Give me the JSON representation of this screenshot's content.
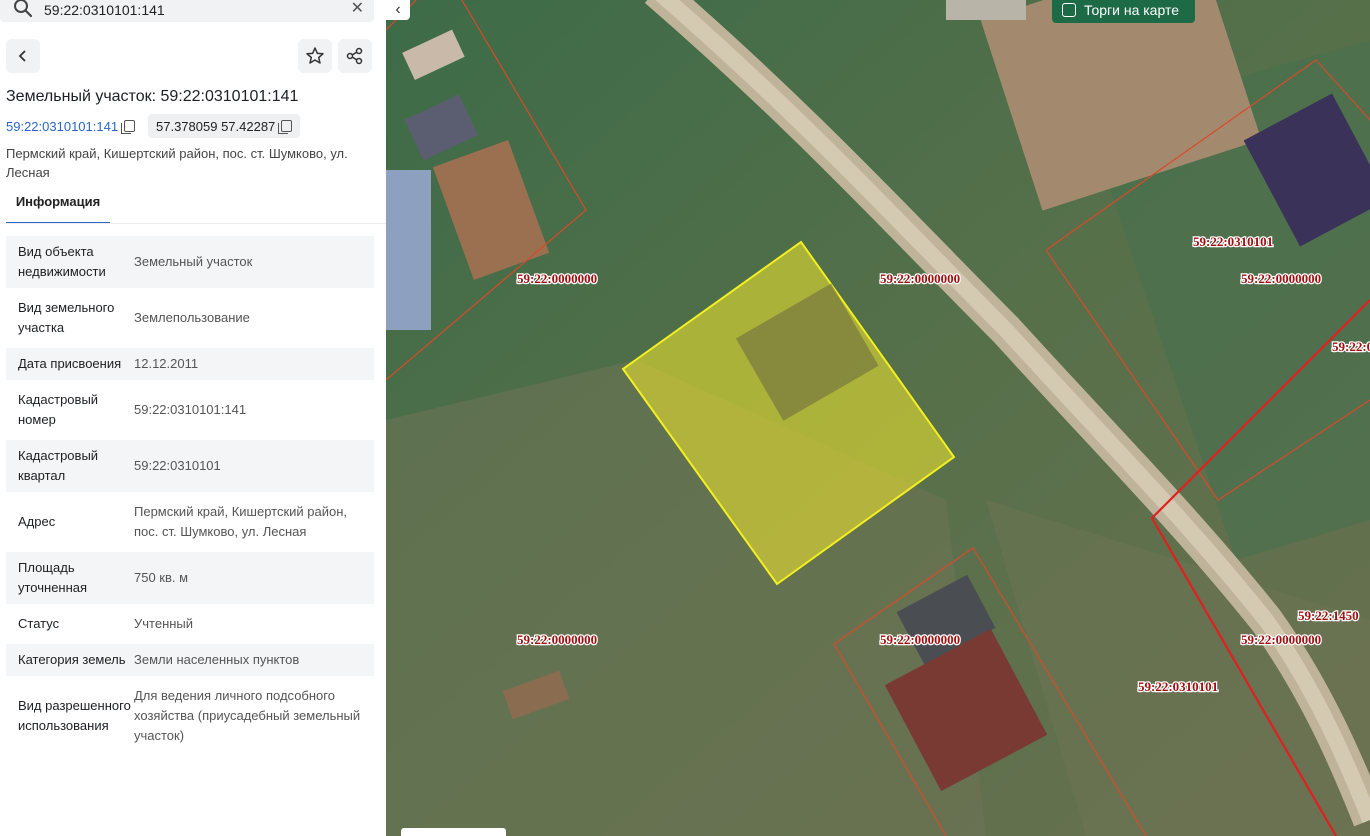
{
  "search": {
    "value": "59:22:0310101:141"
  },
  "panel": {
    "title": "Земельный участок: 59:22:0310101:141",
    "cad_link": "59:22:0310101:141",
    "coords": "57.378059 57.42287",
    "address": "Пермский край, Кишертский район, пос. ст. Шумково, ул. Лесная",
    "tab": "Информация",
    "rows": [
      {
        "label": "Вид объекта недвижимости",
        "value": "Земельный участок"
      },
      {
        "label": "Вид земельного участка",
        "value": "Землепользование"
      },
      {
        "label": "Дата присвоения",
        "value": "12.12.2011"
      },
      {
        "label": "Кадастровый номер",
        "value": "59:22:0310101:141"
      },
      {
        "label": "Кадастровый квартал",
        "value": "59:22:0310101"
      },
      {
        "label": "Адрес",
        "value": "Пермский край, Кишертский район, пос. ст. Шумково, ул. Лесная"
      },
      {
        "label": "Площадь уточненная",
        "value": "750 кв. м"
      },
      {
        "label": "Статус",
        "value": "Учтенный"
      },
      {
        "label": "Категория земель",
        "value": "Земли населенных пунктов"
      },
      {
        "label": "Вид разрешенного использования",
        "value": "Для ведения личного подсобного хозяйства (приусадебный земельный участок)"
      }
    ]
  },
  "map": {
    "auction_button": "Торги на карте",
    "labels": [
      "59:22:0000000",
      "59:22:0000000",
      "59:22:0310101",
      "59:22:0000000",
      "59:22:0",
      "59:22:0000000",
      "59:22:0000000",
      "59:22:1450",
      "59:22:0000000",
      "59:22:0310101"
    ],
    "colors": {
      "selected_fill": "#e8e030",
      "boundary": "#d84a2a",
      "quarter_boundary": "#e02020"
    }
  }
}
